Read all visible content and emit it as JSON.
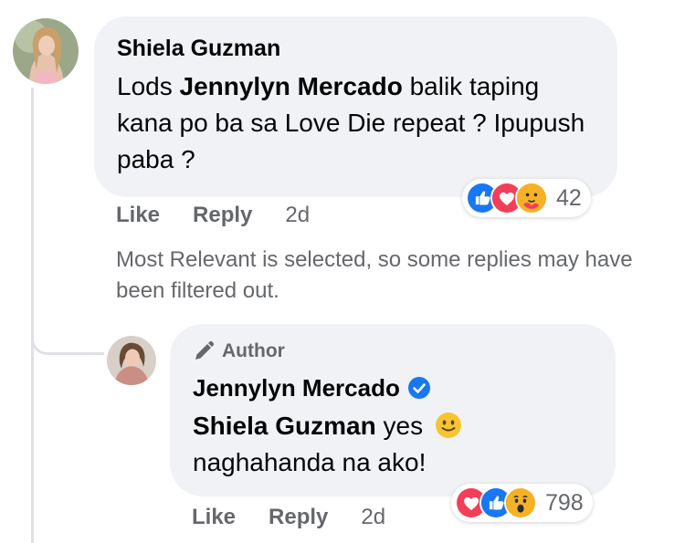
{
  "comment": {
    "author": "Shiela Guzman",
    "text_before": "Lods ",
    "mention": "Jennylyn Mercado",
    "text_after": " balik taping kana po ba sa Love Die repeat ? Ipupush paba ?",
    "actions": {
      "like": "Like",
      "reply": "Reply",
      "time": "2d"
    },
    "reactions": {
      "icons": [
        "like-icon",
        "love-icon",
        "care-icon"
      ],
      "count": "42"
    }
  },
  "notice": "Most Relevant is selected, so some replies may have been filtered out.",
  "reply": {
    "badge": "Author",
    "author": "Jennylyn Mercado",
    "mention": "Shiela Guzman",
    "text_after": " yes",
    "text_line2": "naghahanda na ako!",
    "actions": {
      "like": "Like",
      "reply": "Reply",
      "time": "2d"
    },
    "reactions": {
      "icons": [
        "love-icon",
        "like-icon",
        "wow-icon"
      ],
      "count": "798"
    }
  },
  "colors": {
    "bubble": "#f0f2f5",
    "meta": "#65676b",
    "like": "#1877f2",
    "love": "#f33e58",
    "emoji": "#f7b125"
  }
}
